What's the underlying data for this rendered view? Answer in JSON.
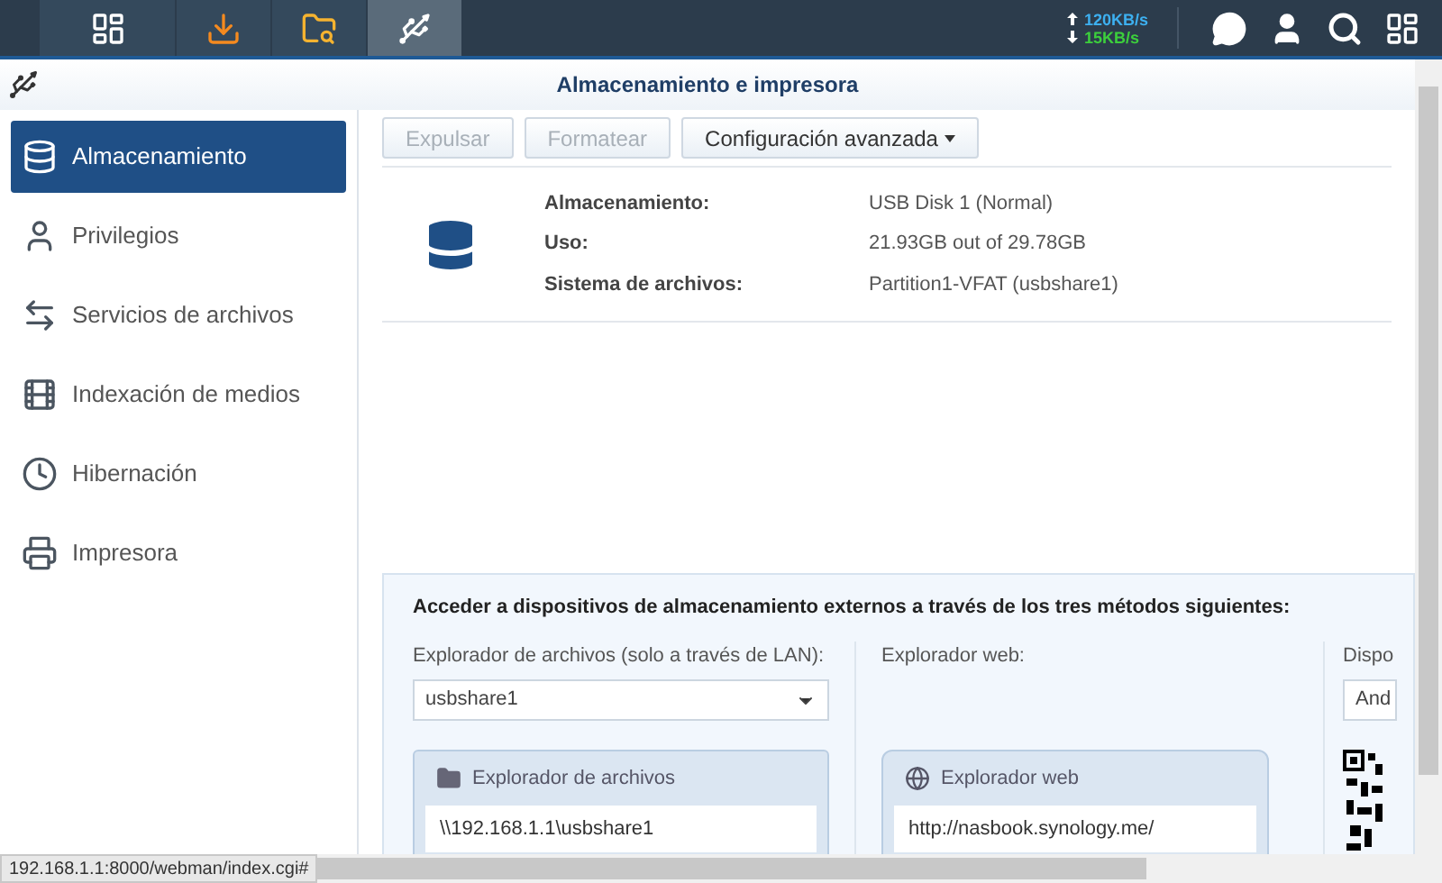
{
  "taskbar": {
    "apps": [
      {
        "selected": false
      },
      {
        "selected": false
      },
      {
        "selected": false
      },
      {
        "selected": true
      }
    ],
    "upload": "120KB/s",
    "download": "15KB/s"
  },
  "window": {
    "title": "Almacenamiento e impresora"
  },
  "sidebar": {
    "items": [
      {
        "label": "Almacenamiento",
        "selected": true
      },
      {
        "label": "Privilegios",
        "selected": false
      },
      {
        "label": "Servicios de archivos",
        "selected": false
      },
      {
        "label": "Indexación de medios",
        "selected": false
      },
      {
        "label": "Hibernación",
        "selected": false
      },
      {
        "label": "Impresora",
        "selected": false
      }
    ]
  },
  "toolbar": {
    "buttons": [
      {
        "label": "Expulsar",
        "disabled": true,
        "dropdown": false
      },
      {
        "label": "Formatear",
        "disabled": true,
        "dropdown": false
      },
      {
        "label": "Configuración avanzada",
        "disabled": false,
        "dropdown": true
      }
    ]
  },
  "info": [
    {
      "label": "Almacenamiento:",
      "value": "USB Disk 1 (Normal)"
    },
    {
      "label": "Uso:",
      "value": "21.93GB out of 29.78GB"
    },
    {
      "label": "Sistema de archivos:",
      "value": "Partition1-VFAT (usbshare1)"
    }
  ],
  "access": {
    "heading": "Acceder a dispositivos de almacenamiento externos a través de los tres métodos siguientes:",
    "columns": [
      {
        "label": "Explorador de archivos (solo a través de LAN):",
        "select": "usbshare1",
        "panel_title": "Explorador de archivos",
        "path": "\\\\192.168.1.1\\usbshare1"
      },
      {
        "label": "Explorador web:",
        "panel_title": "Explorador web",
        "path": "http://nasbook.synology.me/"
      },
      {
        "label": "Dispo",
        "select": "And"
      }
    ]
  },
  "status_bar": {
    "url": "192.168.1.1:8000/webman/index.cgi#"
  }
}
